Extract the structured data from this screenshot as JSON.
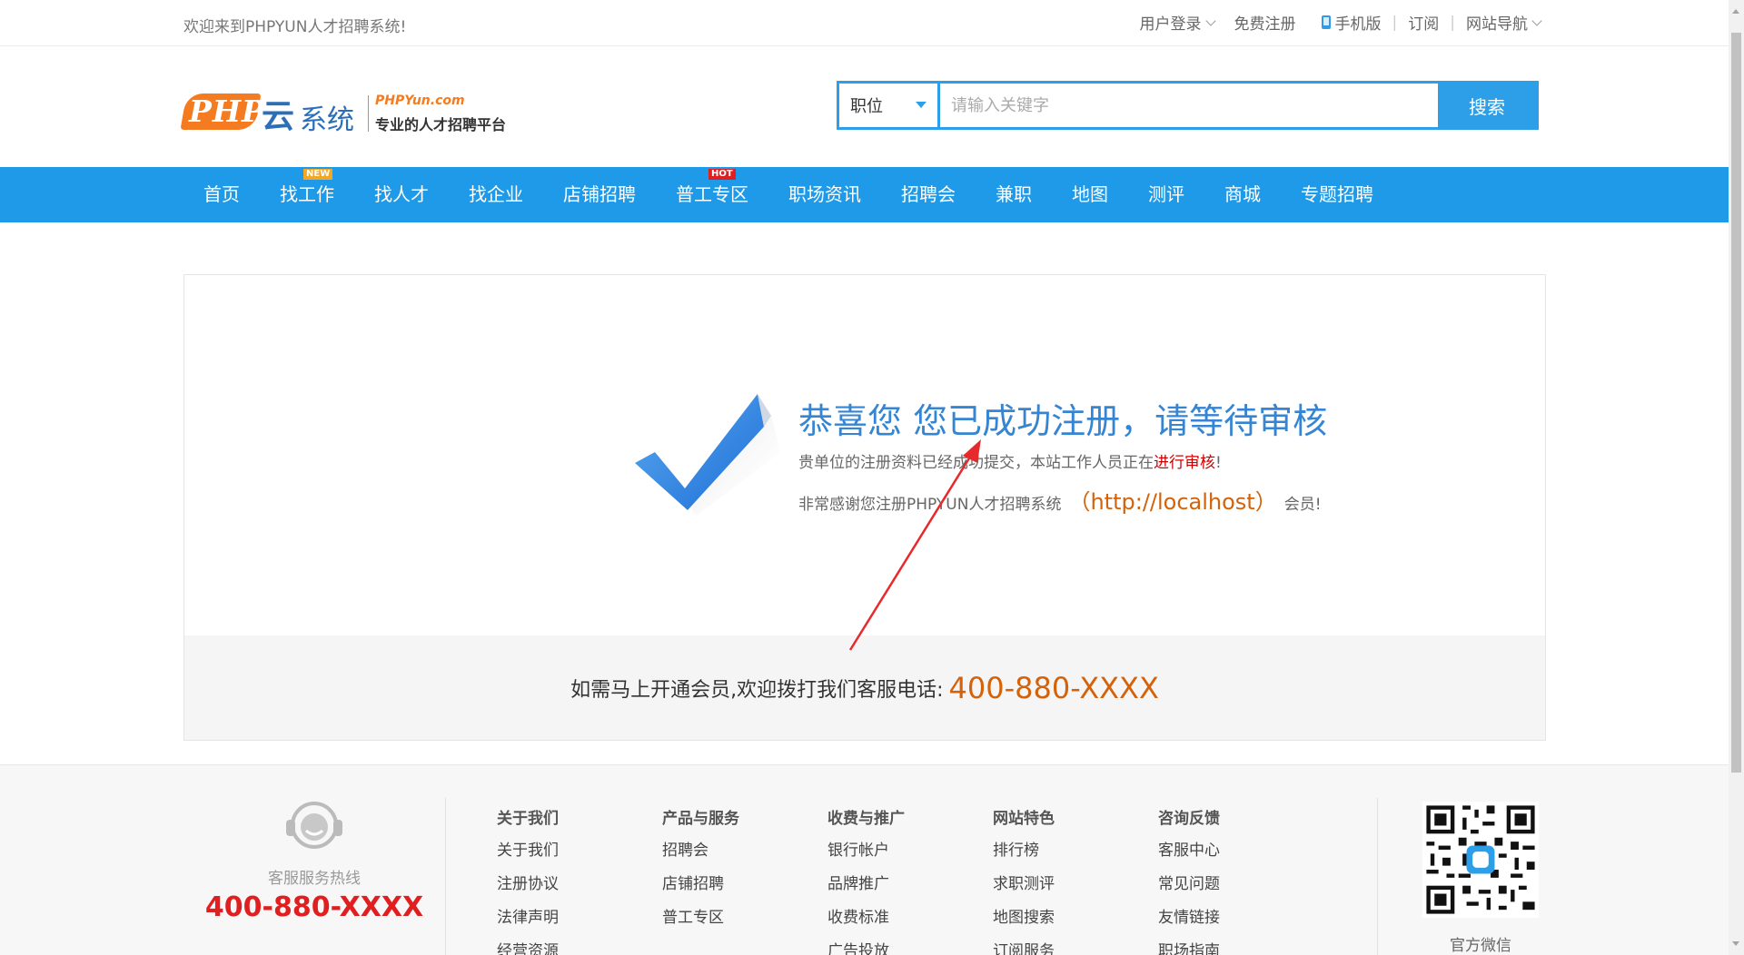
{
  "topbar": {
    "welcome": "欢迎来到PHPYUN人才招聘系统!",
    "login": "用户登录",
    "register": "免费注册",
    "mobile": "手机版",
    "subscribe": "订阅",
    "site_nav": "网站导航"
  },
  "logo": {
    "php": "PHP",
    "yun": "云",
    "system": "系统",
    "domain": "PHPYun.com",
    "slogan": "专业的人才招聘平台"
  },
  "search": {
    "type": "职位",
    "placeholder": "请输入关键字",
    "button": "搜索"
  },
  "nav": {
    "items": [
      {
        "label": "首页"
      },
      {
        "label": "找工作",
        "badge": "NEW"
      },
      {
        "label": "找人才"
      },
      {
        "label": "找企业"
      },
      {
        "label": "店铺招聘"
      },
      {
        "label": "普工专区",
        "badge": "HOT"
      },
      {
        "label": "职场资讯"
      },
      {
        "label": "招聘会"
      },
      {
        "label": "兼职"
      },
      {
        "label": "地图"
      },
      {
        "label": "测评"
      },
      {
        "label": "商城"
      },
      {
        "label": "专题招聘"
      }
    ]
  },
  "success": {
    "title": "恭喜您 您已成功注册，请等待审核",
    "line1_prefix": "贵单位的注册资料已经成功提交，本站工作人员正在",
    "line1_highlight": "进行审核",
    "line1_suffix": "!",
    "line2_prefix": "非常感谢您注册PHPYUN人才招聘系统",
    "line2_url": "（http://localhost）",
    "line2_suffix": "会员!",
    "contact_text": "如需马上开通会员,欢迎拨打我们客服电话:",
    "contact_tel": "400-880-XXXX"
  },
  "footer": {
    "hotline_label": "客服服务热线",
    "hotline_tel": "400-880-XXXX",
    "columns": [
      {
        "title": "关于我们",
        "items": [
          "关于我们",
          "注册协议",
          "法律声明",
          "经营资源"
        ]
      },
      {
        "title": "产品与服务",
        "items": [
          "招聘会",
          "店铺招聘",
          "普工专区"
        ]
      },
      {
        "title": "收费与推广",
        "items": [
          "银行帐户",
          "品牌推广",
          "收费标准",
          "广告投放"
        ]
      },
      {
        "title": "网站特色",
        "items": [
          "排行榜",
          "求职测评",
          "地图搜索",
          "订阅服务"
        ]
      },
      {
        "title": "咨询反馈",
        "items": [
          "客服中心",
          "常见问题",
          "友情链接",
          "职场指南"
        ]
      }
    ],
    "qr_label": "官方微信"
  },
  "colors": {
    "primary": "#1e9ae8",
    "orange": "#d4620a",
    "red": "#e02020"
  }
}
